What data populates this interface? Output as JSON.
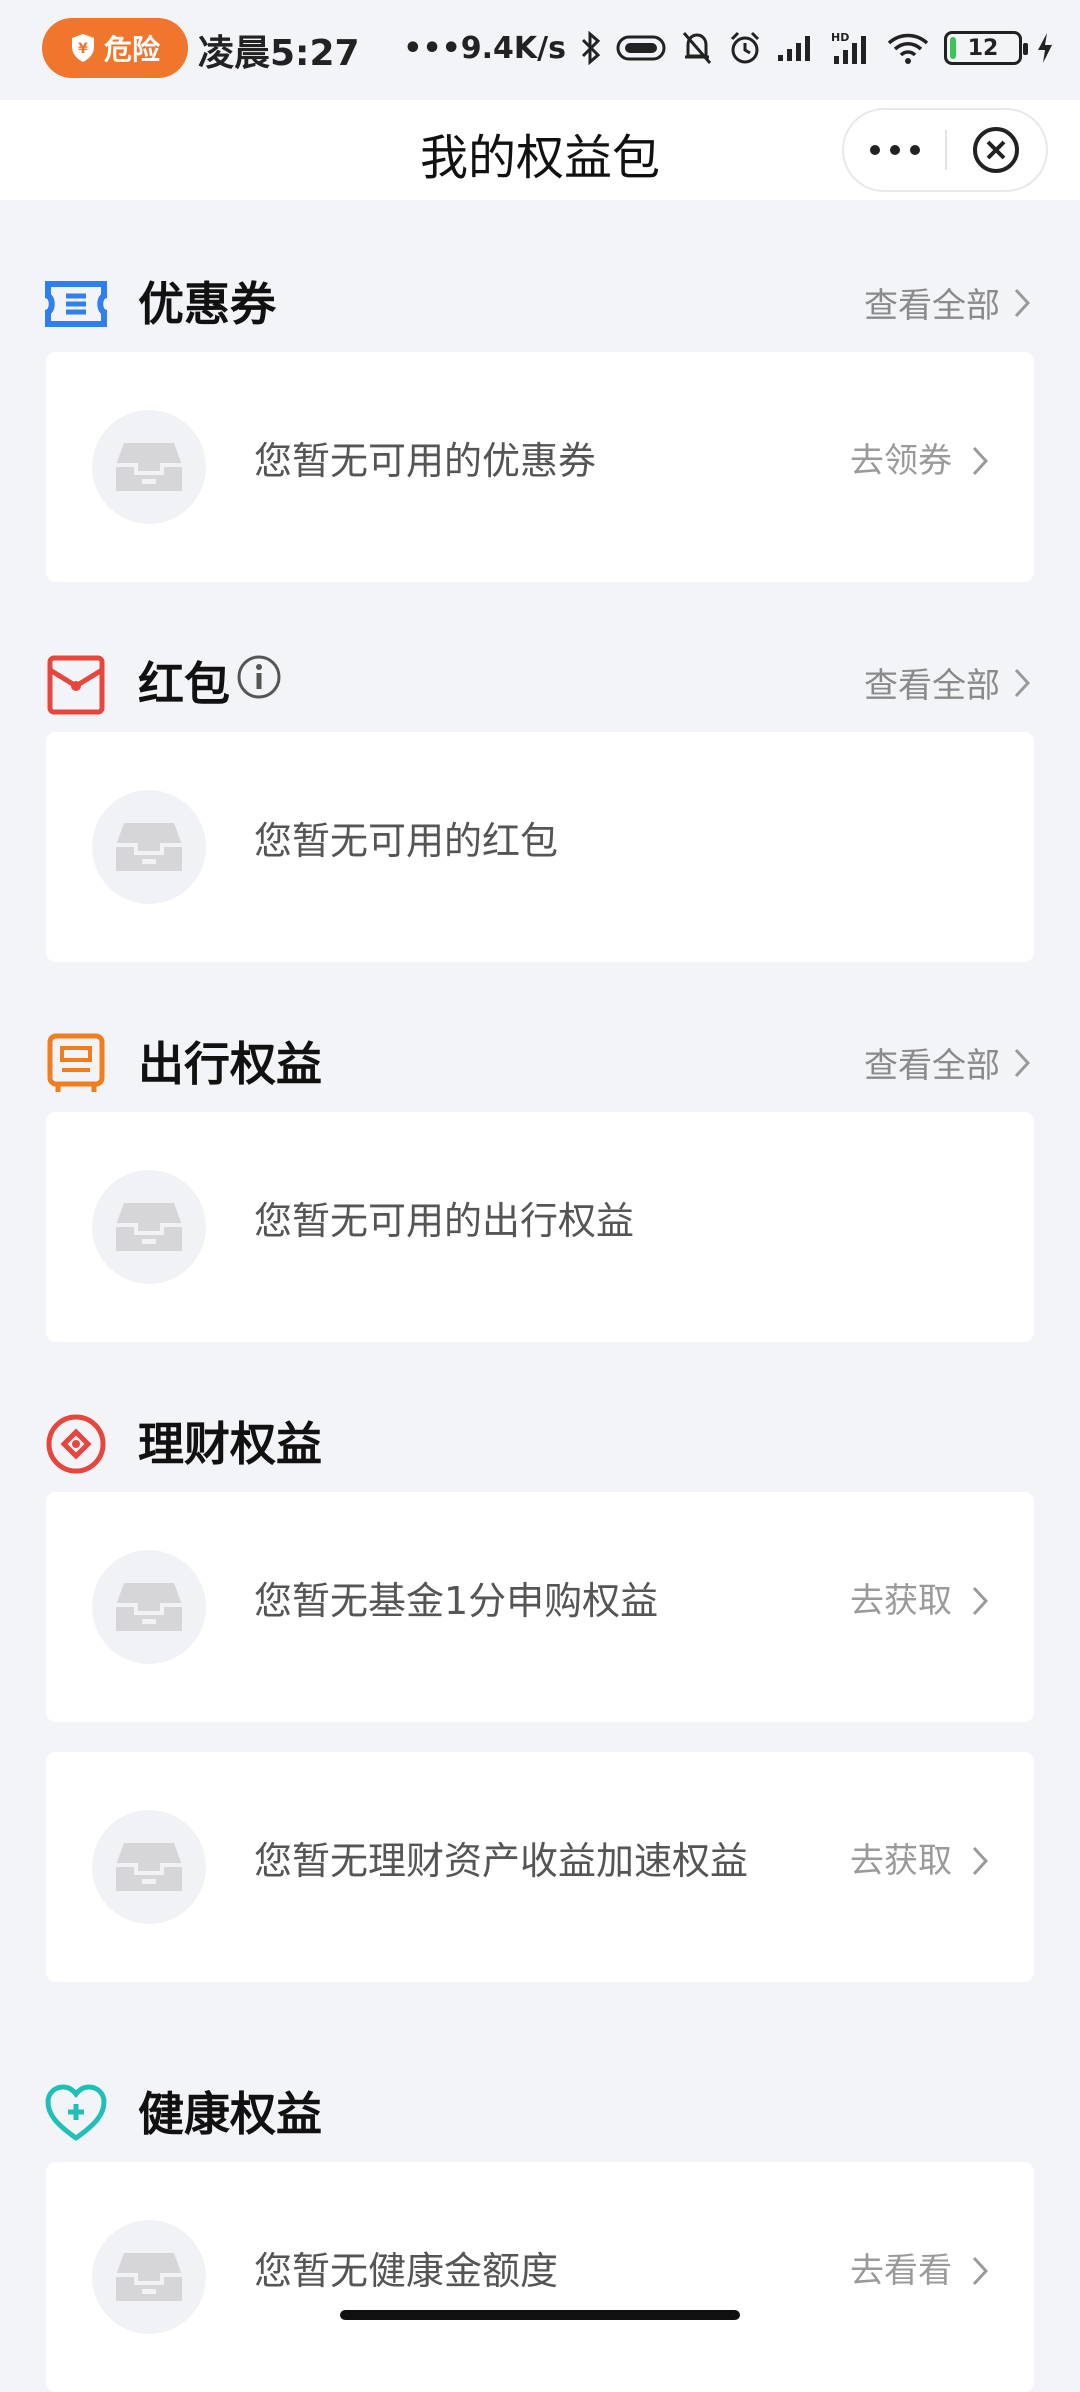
{
  "status_bar": {
    "danger_label": "危险",
    "time": "凌晨5:27",
    "network_speed": "•••9.4K/s",
    "battery_level": "12"
  },
  "nav": {
    "title": "我的权益包"
  },
  "sections": {
    "coupon": {
      "title": "优惠券",
      "view_all": "查看全部",
      "cards": [
        {
          "text": "您暂无可用的优惠券",
          "action": "去领券"
        }
      ]
    },
    "red_packet": {
      "title": "红包",
      "view_all": "查看全部",
      "cards": [
        {
          "text": "您暂无可用的红包"
        }
      ]
    },
    "travel": {
      "title": "出行权益",
      "view_all": "查看全部",
      "cards": [
        {
          "text": "您暂无可用的出行权益"
        }
      ]
    },
    "finance": {
      "title": "理财权益",
      "cards": [
        {
          "text": "您暂无基金1分申购权益",
          "action": "去获取"
        },
        {
          "text": "您暂无理财资产收益加速权益",
          "action": "去获取"
        }
      ]
    },
    "health": {
      "title": "健康权益",
      "cards": [
        {
          "text": "您暂无健康金额度",
          "action": "去看看"
        }
      ]
    }
  },
  "colors": {
    "background": "#f3f4f8",
    "coupon_icon": "#2f7ff0",
    "red_packet_icon": "#e8463c",
    "travel_icon": "#f07d1e",
    "finance_icon": "#e8463c",
    "health_icon": "#20c0b8",
    "danger_pill": "#f0762e"
  },
  "icons": {
    "coupon": "ticket-icon",
    "red_packet": "red-envelope-icon",
    "travel": "travel-card-icon",
    "finance": "finance-target-icon",
    "health": "health-heart-icon",
    "empty": "empty-inbox-icon"
  }
}
